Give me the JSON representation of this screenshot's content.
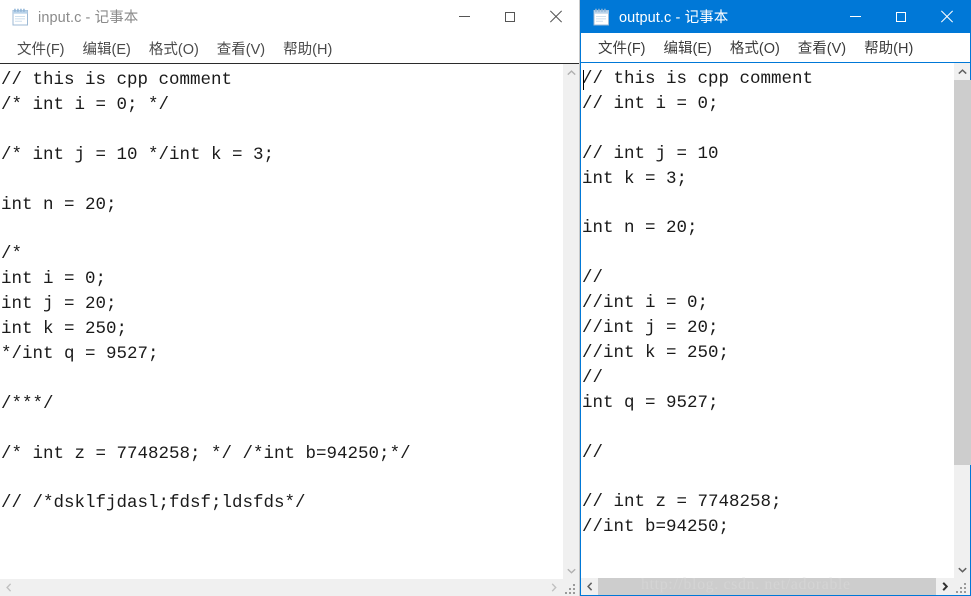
{
  "windows": {
    "left": {
      "title": "input.c - 记事本",
      "active": false,
      "icon": "notepad-icon",
      "menu": [
        "文件(F)",
        "编辑(E)",
        "格式(O)",
        "查看(V)",
        "帮助(H)"
      ],
      "controls": {
        "minimize": "最小化",
        "maximize": "最大化",
        "close": "关闭"
      },
      "content": "// this is cpp comment\n/* int i = 0; */\n\n/* int j = 10 */int k = 3;\n\nint n = 20;\n\n/*\nint i = 0;\nint j = 20;\nint k = 250;\n*/int q = 9527;\n\n/***/\n\n/* int z = 7748258; */ /*int b=94250;*/\n\n// /*dsklfjdasl;fdsf;ldsfds*/\n"
    },
    "right": {
      "title": "output.c - 记事本",
      "active": true,
      "icon": "notepad-icon",
      "menu": [
        "文件(F)",
        "编辑(E)",
        "格式(O)",
        "查看(V)",
        "帮助(H)"
      ],
      "controls": {
        "minimize": "最小化",
        "maximize": "最大化",
        "close": "关闭"
      },
      "content": "// this is cpp comment\n// int i = 0;\n\n// int j = 10\nint k = 3;\n\nint n = 20;\n\n//\n//int i = 0;\n//int j = 20;\n//int k = 250;\n//\nint q = 9527;\n\n//\n\n// int z = 7748258;\n//int b=94250;\n"
    }
  },
  "watermark": "http://blog. csdn. net/adorable",
  "colors": {
    "active_titlebar": "#0078d7",
    "active_border": "#0078d7",
    "inactive_title_text": "#8a8a8a",
    "scrollbar_thumb": "#cdcdcd",
    "scrollbar_track": "#f0f0f0",
    "text": "#1a1a1a"
  },
  "icons": {
    "minimize": "minimize-icon",
    "maximize": "maximize-icon",
    "close": "close-icon",
    "scroll_up": "chevron-up-icon",
    "scroll_down": "chevron-down-icon",
    "scroll_left": "chevron-left-icon",
    "scroll_right": "chevron-right-icon",
    "resize": "resize-grip-icon"
  }
}
